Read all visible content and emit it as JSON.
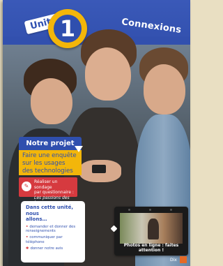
{
  "header": {
    "unite_label": "Unité",
    "unit_number": "1",
    "title": "Connexions"
  },
  "projet": {
    "title": "Notre projet final",
    "lines": [
      "Faire une enquête",
      "sur les usages",
      "des technologies"
    ]
  },
  "sondage": {
    "icon": "survey-icon",
    "lines": [
      "Réaliser un sondage",
      "par questionnaire :",
      "Les passions des jeunes"
    ]
  },
  "objectives": {
    "title_lines": [
      "Dans cette unité, nous",
      "allons…"
    ],
    "items": [
      [
        "demander et donner des",
        "renseignements"
      ],
      [
        "communiquer par téléphone"
      ],
      [
        "donner notre avis"
      ]
    ]
  },
  "video": {
    "caption": "Photos en ligne : faites attention !"
  },
  "footer": {
    "page_number": "Dix"
  },
  "colors": {
    "brand_blue": "#2f4fae",
    "accent_yellow": "#f3b60a",
    "accent_red": "#d63a3f"
  }
}
